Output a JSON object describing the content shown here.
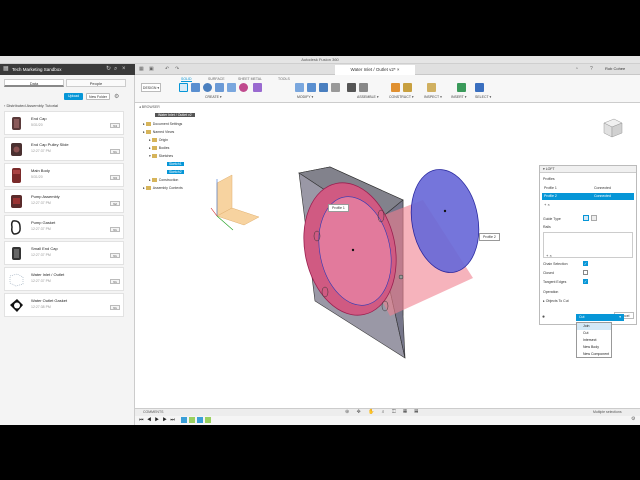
{
  "window": {
    "title": "Autodesk Fusion 360"
  },
  "data_panel": {
    "team_name": "Tech Marketing Sandbox",
    "tabs": [
      {
        "label": "Data"
      },
      {
        "label": "People"
      }
    ],
    "upload_label": "Upload",
    "new_folder_label": "New Folder",
    "project_name": "Distributed Assembly Tutorial",
    "files": [
      {
        "name": "End Cap",
        "date": "5/31/20",
        "version": "V4"
      },
      {
        "name": "End Cap Pulley Slide",
        "date": "12:27:37 PM",
        "version": "V1"
      },
      {
        "name": "Main Body",
        "date": "5/31/20",
        "version": "V3"
      },
      {
        "name": "Pump Assembly",
        "date": "12:27:37 PM",
        "version": "V2"
      },
      {
        "name": "Pump Gasket",
        "date": "12:27:37 PM",
        "version": "V1"
      },
      {
        "name": "Small End Cap",
        "date": "12:27:37 PM",
        "version": "V1"
      },
      {
        "name": "Water Inlet / Outlet",
        "date": "12:27:37 PM",
        "version": "V1"
      },
      {
        "name": "Water Outlet Gasket",
        "date": "12:27:38 PM",
        "version": "V1"
      }
    ]
  },
  "document": {
    "tab_title": "Water Inlet / Outlet v2*",
    "user": "Rob Cohee"
  },
  "ribbon": {
    "workspace": "DESIGN",
    "tabs": [
      "SOLID",
      "SURFACE",
      "SHEET METAL",
      "TOOLS"
    ],
    "groups": [
      "CREATE",
      "MODIFY",
      "ASSEMBLE",
      "CONSTRUCT",
      "INSPECT",
      "INSERT",
      "SELECT"
    ]
  },
  "browser": {
    "header": "BROWSER",
    "root": "Water Inlet / Outlet v2",
    "items": [
      {
        "label": "Document Settings"
      },
      {
        "label": "Named Views"
      },
      {
        "label": "Origin"
      },
      {
        "label": "Bodies"
      },
      {
        "label": "Sketches"
      },
      {
        "label": "Sketch1"
      },
      {
        "label": "Sketch2"
      },
      {
        "label": "Construction"
      },
      {
        "label": "Assembly Contexts"
      }
    ]
  },
  "canvas": {
    "label_profile1": "Profile 1",
    "label_profile2": "Profile 2"
  },
  "loft": {
    "title": "LOFT",
    "profiles_label": "Profiles",
    "rows": [
      {
        "name": "Profile 1",
        "status": "Connected"
      },
      {
        "name": "Profile 2",
        "status": "Connected"
      }
    ],
    "guide_type_label": "Guide Type",
    "rails_label": "Rails",
    "chain_selection_label": "Chain Selection",
    "closed_label": "Closed",
    "tangent_edges_label": "Tangent Edges",
    "operation_label": "Operation",
    "operation_value": "Cut",
    "objects_label": "Objects To Cut",
    "cancel_label": "Cancel",
    "operation_options": [
      "Join",
      "Cut",
      "Intersect",
      "New Body",
      "New Component"
    ]
  },
  "comments_label": "COMMENTS",
  "status_text": "Multiple selections"
}
